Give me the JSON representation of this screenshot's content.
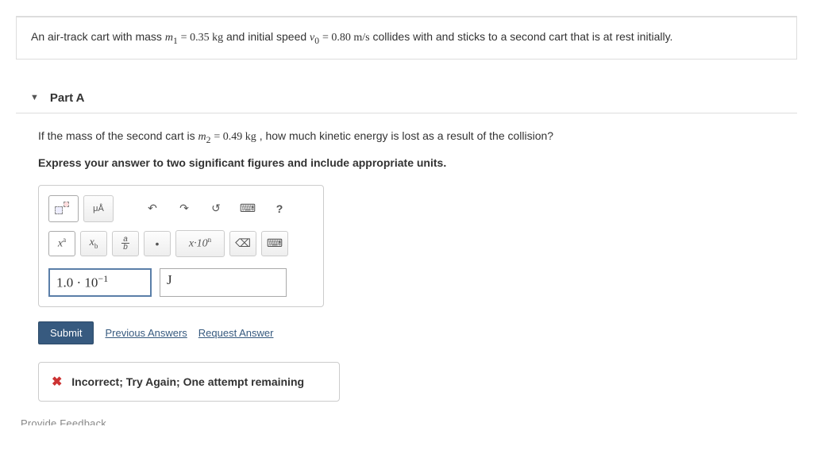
{
  "problem": {
    "text_prefix": "An air-track cart with mass ",
    "m1_var": "m",
    "m1_sub": "1",
    "eq": " = ",
    "m1_val": "0.35 kg",
    "text_mid1": " and initial speed ",
    "v0_var": "v",
    "v0_sub": "0",
    "v0_val": "0.80 m/s",
    "text_suffix": " collides with and sticks to a second cart that is at rest initially."
  },
  "part": {
    "label": "Part A",
    "question_prefix": "If the mass of the second cart is ",
    "m2_var": "m",
    "m2_sub": "2",
    "eq": " = ",
    "m2_val": "0.49 kg",
    "question_suffix": ", how much kinetic energy is lost as a result of the collision?",
    "instruction": "Express your answer to two significant figures and include appropriate units."
  },
  "toolbar": {
    "mu_a": "μÅ",
    "undo": "↶",
    "redo": "↷",
    "reset": "↺",
    "keyboard": "⌨",
    "help": "?",
    "xa": "x",
    "xa_sup": "a",
    "xb": "x",
    "xb_sub": "b",
    "dot": "•",
    "sci": "x·10",
    "sci_sup": "n",
    "clear": "⌫",
    "kbd2": "⌨"
  },
  "answer": {
    "value_display": "1.0 · 10",
    "value_exp": "−1",
    "unit": "J"
  },
  "actions": {
    "submit": "Submit",
    "previous": "Previous Answers",
    "request": "Request Answer"
  },
  "feedback": {
    "icon": "✖",
    "message": "Incorrect; Try Again; One attempt remaining"
  },
  "footer_cut": "Provide Feedback"
}
